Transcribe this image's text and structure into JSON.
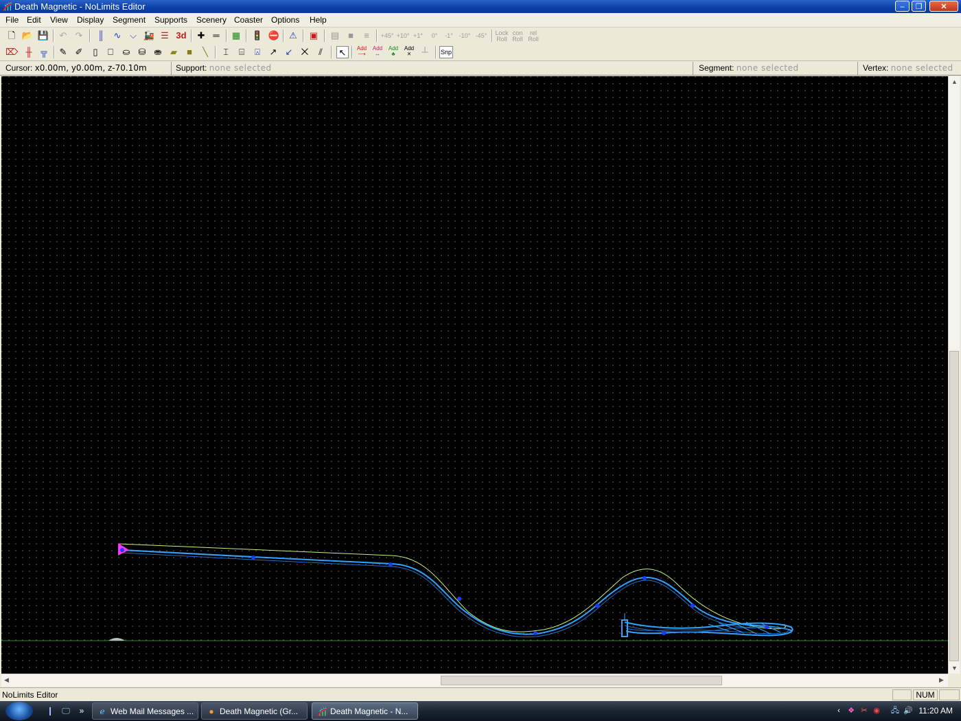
{
  "window": {
    "title": "Death Magnetic - NoLimits Editor"
  },
  "menu": [
    "File",
    "Edit",
    "View",
    "Display",
    "Segment",
    "Supports",
    "Scenery",
    "Coaster",
    "Options",
    "Help"
  ],
  "toolbar1": {
    "angle_buttons": [
      "+45°",
      "+10°",
      "+1°",
      "0°",
      "-1°",
      "-10°",
      "-45°"
    ],
    "roll_lock": "Lock Roll",
    "roll_con": "con Roll",
    "roll_rel": "rel Roll",
    "view3d": "3d"
  },
  "toolbar2": {
    "add_label": "Add",
    "snap": "Snp"
  },
  "info": {
    "cursor_label": "Cursor:",
    "cursor_value": "x0.00m, y0.00m, z-70.10m",
    "support_label": "Support:",
    "support_value": "none selected",
    "segment_label": "Segment:",
    "segment_value": "none selected",
    "vertex_label": "Vertex:",
    "vertex_value": "none selected"
  },
  "status": {
    "text": "NoLimits Editor",
    "num": "NUM"
  },
  "taskbar": {
    "buttons": [
      "Web Mail Messages ...",
      "Death Magnetic (Gr...",
      "Death Magnetic - N..."
    ],
    "clock": "11:20 AM"
  },
  "colors": {
    "track": "#2ea3ff",
    "spine": "#c8f07a",
    "ground": "#2a8a2a",
    "grid": "#6a6a6a",
    "station": "#ff33ff"
  }
}
